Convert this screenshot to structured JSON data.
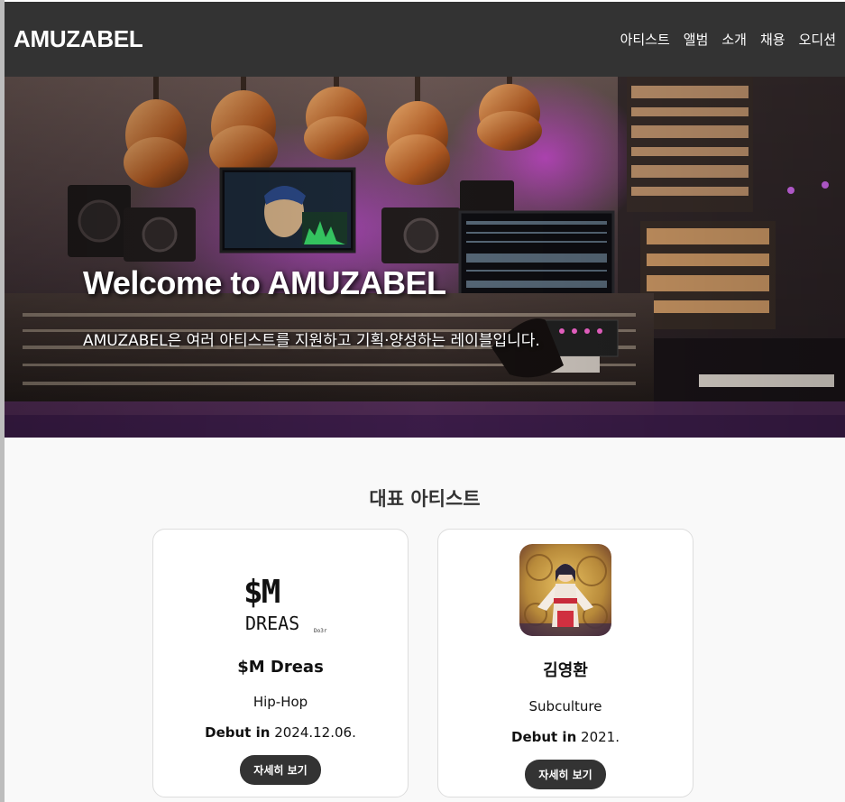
{
  "navbar": {
    "logo": "AMUZABEL",
    "links": [
      "아티스트",
      "앨범",
      "소개",
      "채용",
      "오디션"
    ]
  },
  "hero": {
    "title": "Welcome to AMUZABEL",
    "subtitle": "AMUZABEL은 여러 아티스트를 지원하고 기획·양성하는 레이블입니다."
  },
  "artists_section": {
    "title": "대표 아티스트",
    "button_label": "자세히 보기",
    "debut_label": "Debut in",
    "cards": [
      {
        "name": "$M Dreas",
        "genre": "Hip-Hop",
        "debut": "2024.12.06.",
        "logo_top": "$M",
        "logo_bottom": "DREAS",
        "logo_tag": "Do3r"
      },
      {
        "name": "김영환",
        "genre": "Subculture",
        "debut": "2021."
      }
    ]
  },
  "colors": {
    "navbar": "#333333",
    "page_bg": "#f9f9f9",
    "button": "#333333",
    "hero_accent": "#b03cc8"
  }
}
